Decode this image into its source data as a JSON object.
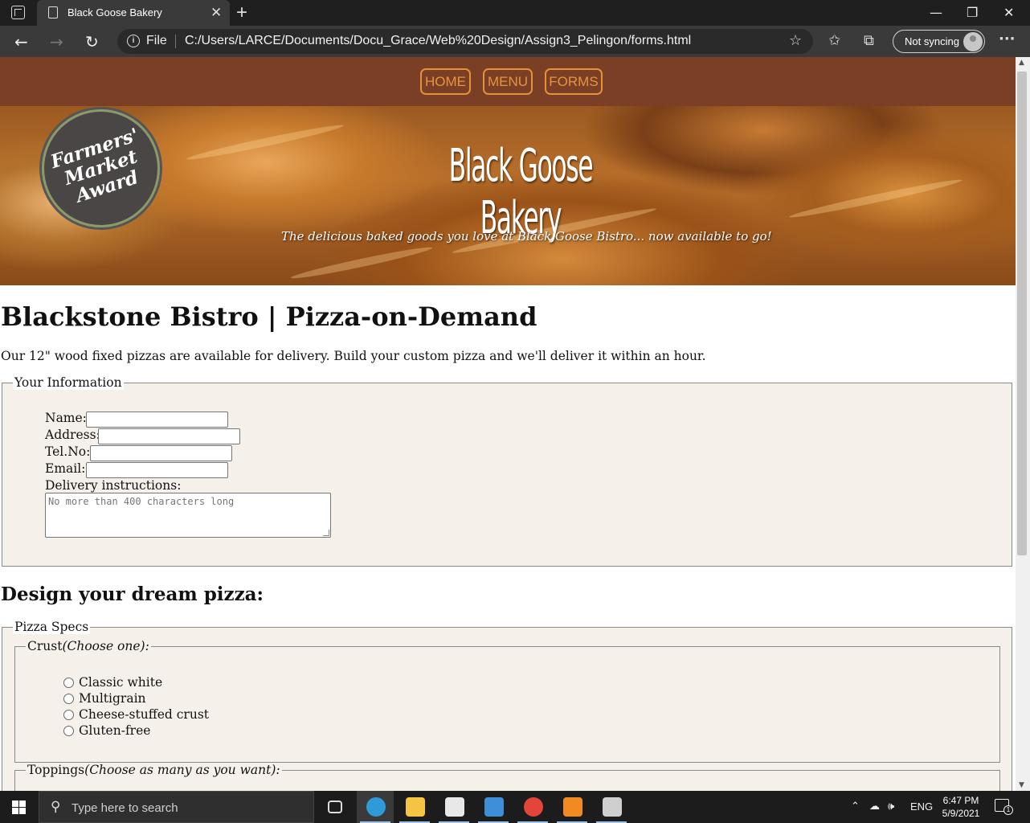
{
  "browser": {
    "tab_title": "Black Goose Bakery",
    "tab_close": "✕",
    "new_tab": "+",
    "window_minimize": "—",
    "window_restore": "❐",
    "window_close": "✕",
    "back": "←",
    "forward": "→",
    "reload": "↻",
    "info": "i",
    "file_label": "File",
    "url": "C:/Users/LARCE/Documents/Docu_Grace/Web%20Design/Assign3_Pelingon/forms.html",
    "add_favorite": "☆",
    "favorites": "✩",
    "collections": "⧉",
    "sync_label": "Not syncing",
    "more": "···"
  },
  "site_nav": {
    "items": [
      {
        "label": "HOME"
      },
      {
        "label": "MENU"
      },
      {
        "label": "FORMS"
      }
    ],
    "accent_color": "#e4913a",
    "bar_color": "#7a3f24"
  },
  "hero": {
    "award_text": "Farmers' Market Award",
    "title": "Black Goose Bakery",
    "tagline": "The delicious baked goods you love at Black Goose Bistro... now available to go!"
  },
  "page": {
    "title": "Blackstone Bistro | Pizza-on-Demand",
    "intro": "Our 12\" wood fixed pizzas are available for delivery. Build your custom pizza and we'll deliver it within an hour."
  },
  "info_form": {
    "legend": "Your Information",
    "fields": [
      {
        "label": "Name:",
        "value": ""
      },
      {
        "label": "Address:",
        "value": ""
      },
      {
        "label": "Tel.No:",
        "value": ""
      },
      {
        "label": "Email:",
        "value": ""
      }
    ],
    "delivery_label": "Delivery instructions:",
    "delivery_placeholder": "No more than 400 characters long"
  },
  "pizza": {
    "heading": "Design your dream pizza:",
    "specs_legend": "Pizza Specs",
    "crust_legend": "Crust",
    "crust_hint": "(Choose one):",
    "crust_options": [
      "Classic white",
      "Multigrain",
      "Cheese-stuffed crust",
      "Gluten-free"
    ],
    "toppings_legend": "Toppings",
    "toppings_hint": "(Choose as many as you want):"
  },
  "taskbar": {
    "search_placeholder": "Type here to search",
    "apps": [
      {
        "name": "task-view",
        "color": "#dddddd"
      },
      {
        "name": "edge",
        "color": "#2e9ad8"
      },
      {
        "name": "file-explorer",
        "color": "#f4c443"
      },
      {
        "name": "store",
        "color": "#e8e8e8"
      },
      {
        "name": "mail",
        "color": "#3f8fd8"
      },
      {
        "name": "chrome",
        "color": "#e4453a"
      },
      {
        "name": "sublime-text",
        "color": "#f28a22"
      },
      {
        "name": "paint",
        "color": "#cfcfcf"
      }
    ],
    "language": "ENG",
    "time": "6:47 PM",
    "date": "5/9/2021",
    "notification_count": "1"
  }
}
